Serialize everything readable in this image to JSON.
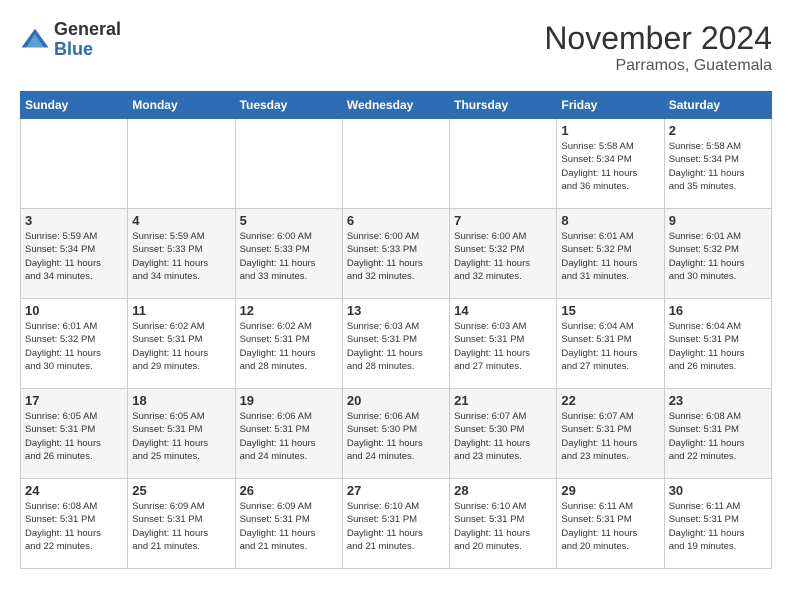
{
  "logo": {
    "general": "General",
    "blue": "Blue"
  },
  "header": {
    "month": "November 2024",
    "location": "Parramos, Guatemala"
  },
  "weekdays": [
    "Sunday",
    "Monday",
    "Tuesday",
    "Wednesday",
    "Thursday",
    "Friday",
    "Saturday"
  ],
  "weeks": [
    [
      {
        "day": "",
        "info": ""
      },
      {
        "day": "",
        "info": ""
      },
      {
        "day": "",
        "info": ""
      },
      {
        "day": "",
        "info": ""
      },
      {
        "day": "",
        "info": ""
      },
      {
        "day": "1",
        "info": "Sunrise: 5:58 AM\nSunset: 5:34 PM\nDaylight: 11 hours\nand 36 minutes."
      },
      {
        "day": "2",
        "info": "Sunrise: 5:58 AM\nSunset: 5:34 PM\nDaylight: 11 hours\nand 35 minutes."
      }
    ],
    [
      {
        "day": "3",
        "info": "Sunrise: 5:59 AM\nSunset: 5:34 PM\nDaylight: 11 hours\nand 34 minutes."
      },
      {
        "day": "4",
        "info": "Sunrise: 5:59 AM\nSunset: 5:33 PM\nDaylight: 11 hours\nand 34 minutes."
      },
      {
        "day": "5",
        "info": "Sunrise: 6:00 AM\nSunset: 5:33 PM\nDaylight: 11 hours\nand 33 minutes."
      },
      {
        "day": "6",
        "info": "Sunrise: 6:00 AM\nSunset: 5:33 PM\nDaylight: 11 hours\nand 32 minutes."
      },
      {
        "day": "7",
        "info": "Sunrise: 6:00 AM\nSunset: 5:32 PM\nDaylight: 11 hours\nand 32 minutes."
      },
      {
        "day": "8",
        "info": "Sunrise: 6:01 AM\nSunset: 5:32 PM\nDaylight: 11 hours\nand 31 minutes."
      },
      {
        "day": "9",
        "info": "Sunrise: 6:01 AM\nSunset: 5:32 PM\nDaylight: 11 hours\nand 30 minutes."
      }
    ],
    [
      {
        "day": "10",
        "info": "Sunrise: 6:01 AM\nSunset: 5:32 PM\nDaylight: 11 hours\nand 30 minutes."
      },
      {
        "day": "11",
        "info": "Sunrise: 6:02 AM\nSunset: 5:31 PM\nDaylight: 11 hours\nand 29 minutes."
      },
      {
        "day": "12",
        "info": "Sunrise: 6:02 AM\nSunset: 5:31 PM\nDaylight: 11 hours\nand 28 minutes."
      },
      {
        "day": "13",
        "info": "Sunrise: 6:03 AM\nSunset: 5:31 PM\nDaylight: 11 hours\nand 28 minutes."
      },
      {
        "day": "14",
        "info": "Sunrise: 6:03 AM\nSunset: 5:31 PM\nDaylight: 11 hours\nand 27 minutes."
      },
      {
        "day": "15",
        "info": "Sunrise: 6:04 AM\nSunset: 5:31 PM\nDaylight: 11 hours\nand 27 minutes."
      },
      {
        "day": "16",
        "info": "Sunrise: 6:04 AM\nSunset: 5:31 PM\nDaylight: 11 hours\nand 26 minutes."
      }
    ],
    [
      {
        "day": "17",
        "info": "Sunrise: 6:05 AM\nSunset: 5:31 PM\nDaylight: 11 hours\nand 26 minutes."
      },
      {
        "day": "18",
        "info": "Sunrise: 6:05 AM\nSunset: 5:31 PM\nDaylight: 11 hours\nand 25 minutes."
      },
      {
        "day": "19",
        "info": "Sunrise: 6:06 AM\nSunset: 5:31 PM\nDaylight: 11 hours\nand 24 minutes."
      },
      {
        "day": "20",
        "info": "Sunrise: 6:06 AM\nSunset: 5:30 PM\nDaylight: 11 hours\nand 24 minutes."
      },
      {
        "day": "21",
        "info": "Sunrise: 6:07 AM\nSunset: 5:30 PM\nDaylight: 11 hours\nand 23 minutes."
      },
      {
        "day": "22",
        "info": "Sunrise: 6:07 AM\nSunset: 5:31 PM\nDaylight: 11 hours\nand 23 minutes."
      },
      {
        "day": "23",
        "info": "Sunrise: 6:08 AM\nSunset: 5:31 PM\nDaylight: 11 hours\nand 22 minutes."
      }
    ],
    [
      {
        "day": "24",
        "info": "Sunrise: 6:08 AM\nSunset: 5:31 PM\nDaylight: 11 hours\nand 22 minutes."
      },
      {
        "day": "25",
        "info": "Sunrise: 6:09 AM\nSunset: 5:31 PM\nDaylight: 11 hours\nand 21 minutes."
      },
      {
        "day": "26",
        "info": "Sunrise: 6:09 AM\nSunset: 5:31 PM\nDaylight: 11 hours\nand 21 minutes."
      },
      {
        "day": "27",
        "info": "Sunrise: 6:10 AM\nSunset: 5:31 PM\nDaylight: 11 hours\nand 21 minutes."
      },
      {
        "day": "28",
        "info": "Sunrise: 6:10 AM\nSunset: 5:31 PM\nDaylight: 11 hours\nand 20 minutes."
      },
      {
        "day": "29",
        "info": "Sunrise: 6:11 AM\nSunset: 5:31 PM\nDaylight: 11 hours\nand 20 minutes."
      },
      {
        "day": "30",
        "info": "Sunrise: 6:11 AM\nSunset: 5:31 PM\nDaylight: 11 hours\nand 19 minutes."
      }
    ]
  ]
}
